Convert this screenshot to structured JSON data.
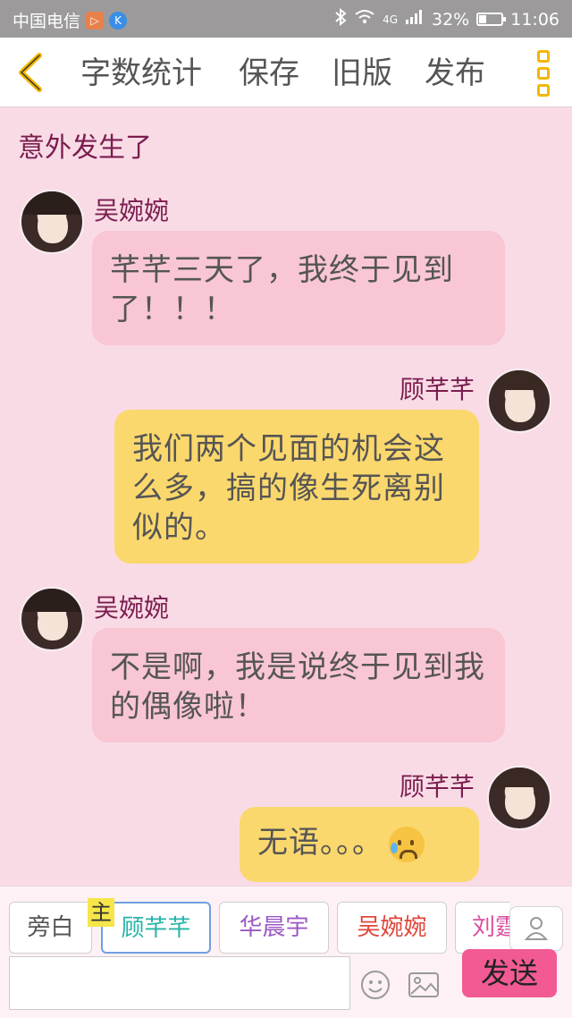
{
  "status_bar": {
    "carrier": "中国电信",
    "network": "4G",
    "battery": "32%",
    "battery_level": 0.32,
    "time": "11:06"
  },
  "toolbar": {
    "word_count": "字数统计",
    "save": "保存",
    "old_version": "旧版",
    "publish": "发布"
  },
  "chapter_title": "意外发生了",
  "messages": [
    {
      "speaker": "吴婉婉",
      "side": "left",
      "text": "芊芊三天了，我终于见到了！！！"
    },
    {
      "speaker": "顾芊芊",
      "side": "right",
      "text": "我们两个见面的机会这么多，搞的像生死离别似的。"
    },
    {
      "speaker": "吴婉婉",
      "side": "left",
      "text": "不是啊，我是说终于见到我的偶像啦！"
    },
    {
      "speaker": "顾芊芊",
      "side": "right",
      "text": "无语。。。",
      "emoji": "sad-sweat-face-emoji"
    }
  ],
  "roles": [
    {
      "label": "旁白",
      "color": "#555555"
    },
    {
      "label": "顾芊芊",
      "color": "#26b3a8",
      "active": true,
      "main_tag": "主"
    },
    {
      "label": "华晨宇",
      "color": "#9b59c4"
    },
    {
      "label": "吴婉婉",
      "color": "#e0473c"
    },
    {
      "label": "刘霆",
      "color": "#d84fa0"
    }
  ],
  "input": {
    "value": "",
    "placeholder": ""
  },
  "send_button": "发送",
  "accent_colors": {
    "send": "#f25a93",
    "bubble_left": "#f9c6d4",
    "bubble_right": "#fbd86d",
    "background": "#f9dbe6"
  }
}
